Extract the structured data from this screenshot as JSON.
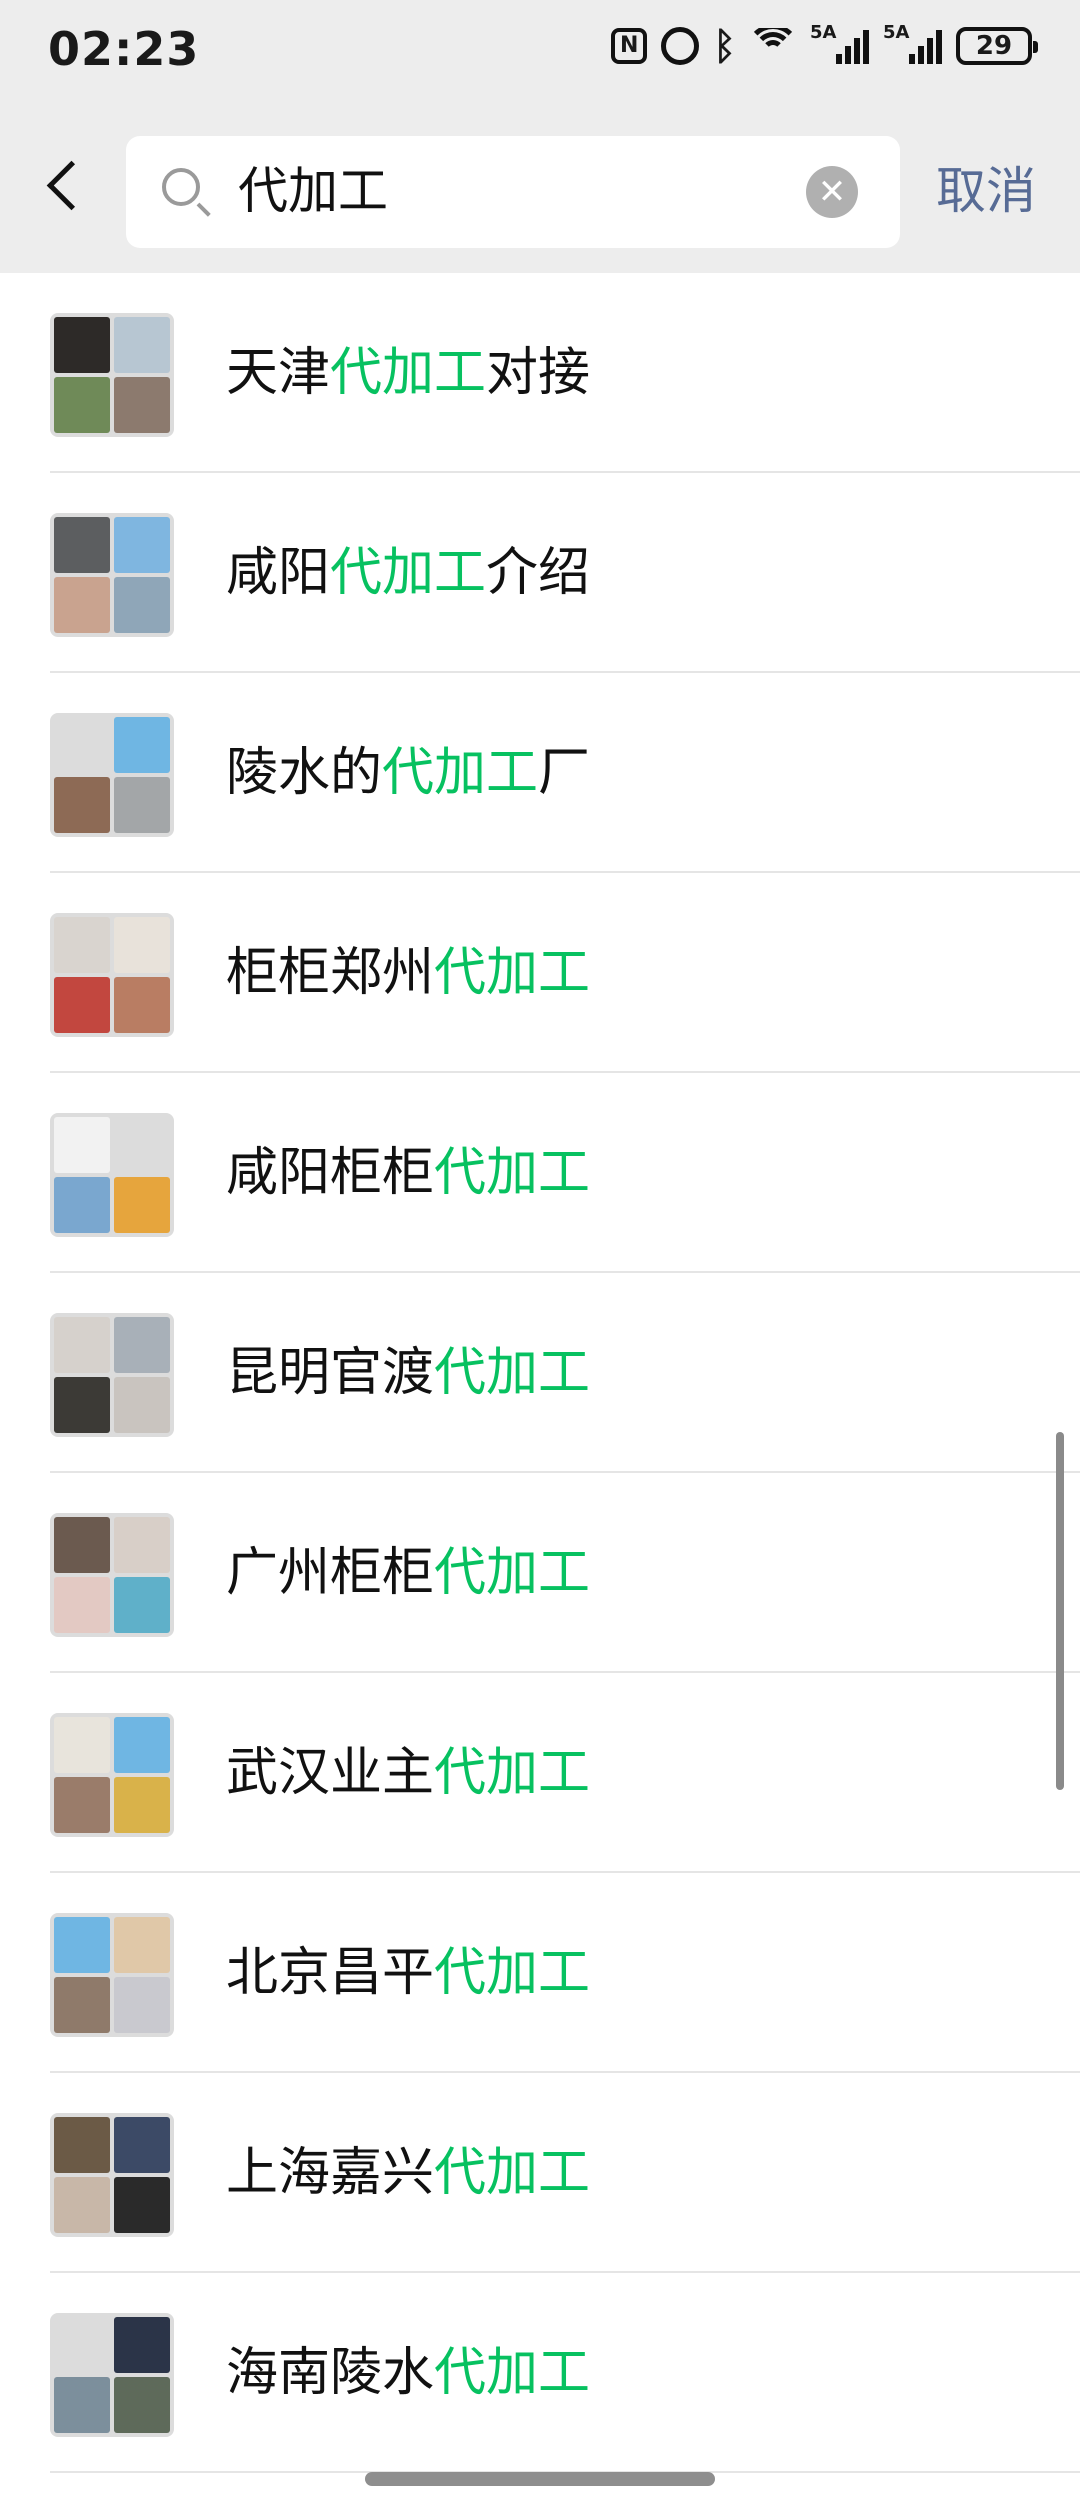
{
  "status_bar": {
    "time": "02:23",
    "nfc_label": "N",
    "signal_1_label": "5A",
    "signal_2_label": "5A",
    "battery": "29"
  },
  "search": {
    "query": "代加工",
    "clear_symbol": "✕",
    "cancel_label": "取消"
  },
  "results": [
    {
      "prefix": "天津",
      "highlight": "代加工",
      "suffix": "对接",
      "avatar_colors": [
        "#2d2a28",
        "#b7c6d2",
        "#6f8a58",
        "#8c7a6e"
      ]
    },
    {
      "prefix": "咸阳",
      "highlight": "代加工",
      "suffix": "介绍",
      "avatar_colors": [
        "#5c5e60",
        "#7fb6e0",
        "#c9a38f",
        "#8fa6b8"
      ]
    },
    {
      "prefix": "陵水的",
      "highlight": "代加工",
      "suffix": "厂",
      "avatar_colors": [
        "#dcdcdc",
        "#6fb6e3",
        "#8d6a55",
        "#a3a6a8"
      ]
    },
    {
      "prefix": "柜柜郑州",
      "highlight": "代加工",
      "suffix": "",
      "avatar_colors": [
        "#d9d4cf",
        "#e8e2da",
        "#c2473f",
        "#b97d63"
      ]
    },
    {
      "prefix": "咸阳柜柜",
      "highlight": "代加工",
      "suffix": "",
      "avatar_colors": [
        "#f2f2f2",
        "#dcdcdc",
        "#7aa7cf",
        "#e6a53d"
      ]
    },
    {
      "prefix": "昆明官渡",
      "highlight": "代加工",
      "suffix": "",
      "avatar_colors": [
        "#d6d1cc",
        "#a8b0b8",
        "#3c3a36",
        "#c9c4bf"
      ]
    },
    {
      "prefix": "广州柜柜",
      "highlight": "代加工",
      "suffix": "",
      "avatar_colors": [
        "#6b5a4f",
        "#d8cfc8",
        "#e3c9c3",
        "#5fb0c9"
      ]
    },
    {
      "prefix": "武汉业主",
      "highlight": "代加工",
      "suffix": "",
      "avatar_colors": [
        "#e8e4dc",
        "#6fb6e3",
        "#9a7c6a",
        "#d9b24a"
      ]
    },
    {
      "prefix": "北京昌平",
      "highlight": "代加工",
      "suffix": "",
      "avatar_colors": [
        "#6fb6e3",
        "#e0c8a8",
        "#8f7a6a",
        "#c9c9cf"
      ]
    },
    {
      "prefix": "上海嘉兴",
      "highlight": "代加工",
      "suffix": "",
      "avatar_colors": [
        "#6b5a46",
        "#3c4a66",
        "#c8b7a8",
        "#2a2a2a"
      ]
    },
    {
      "prefix": "海南陵水",
      "highlight": "代加工",
      "suffix": "",
      "avatar_colors": [
        "#dcdcdc",
        "#2b3448",
        "#7c8f9c",
        "#5e6a5a"
      ]
    }
  ]
}
